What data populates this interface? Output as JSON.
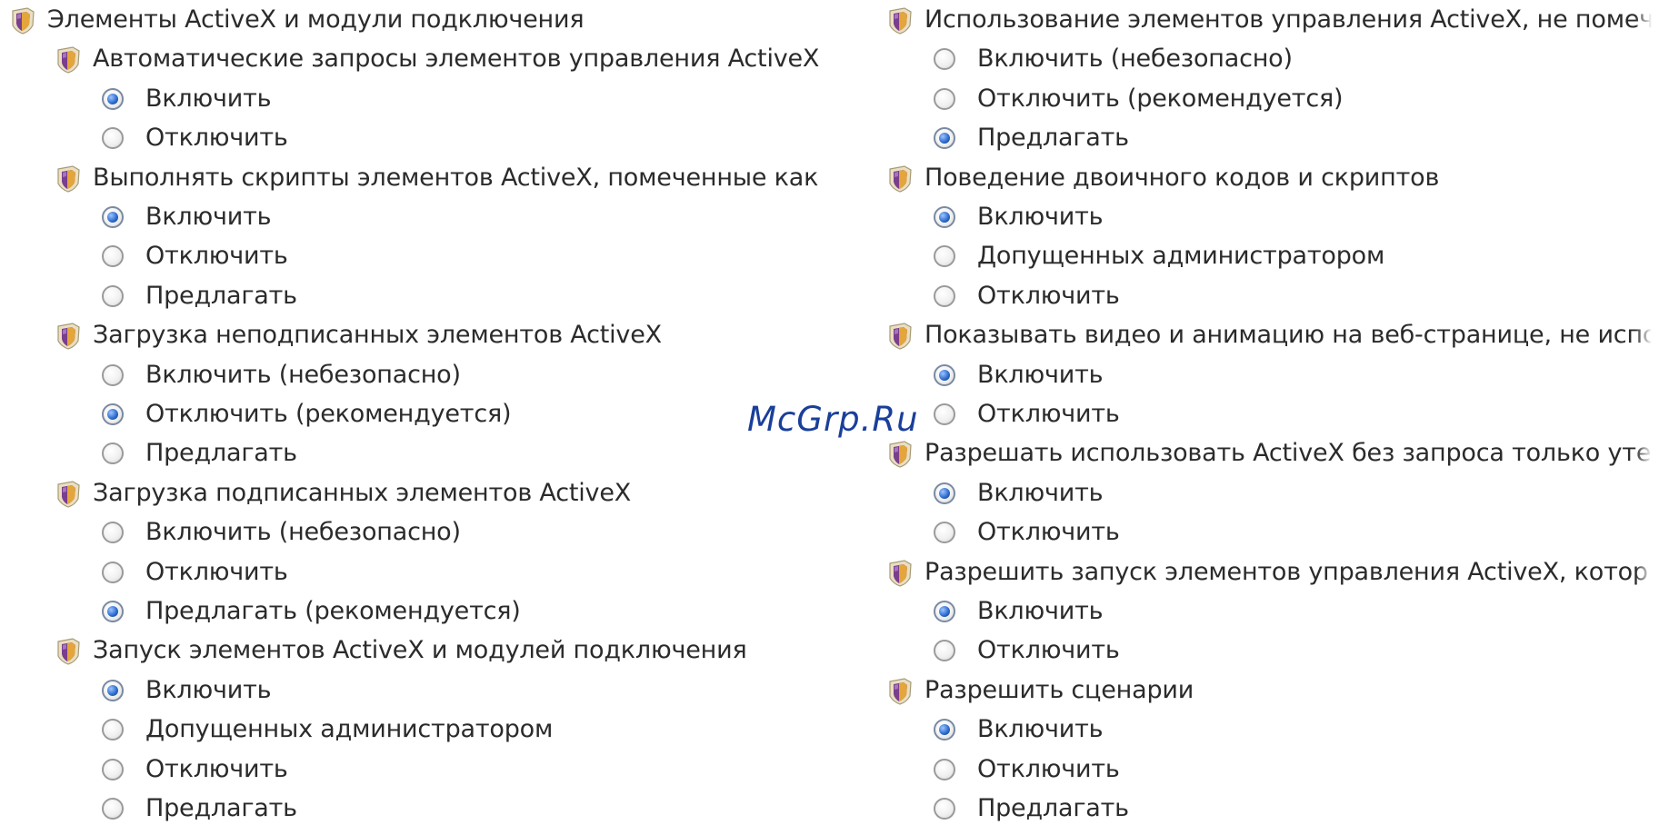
{
  "left_column": [
    {
      "type": "group",
      "label": "Элементы ActiveX и модули подключения",
      "level": 0
    },
    {
      "type": "setting",
      "label": "Автоматические запросы элементов управления ActiveX",
      "level": 1
    },
    {
      "type": "option",
      "label": "Включить",
      "selected": true
    },
    {
      "type": "option",
      "label": "Отключить",
      "selected": false
    },
    {
      "type": "setting",
      "label": "Выполнять скрипты элементов ActiveX, помеченные как",
      "level": 1
    },
    {
      "type": "option",
      "label": "Включить",
      "selected": true
    },
    {
      "type": "option",
      "label": "Отключить",
      "selected": false
    },
    {
      "type": "option",
      "label": "Предлагать",
      "selected": false
    },
    {
      "type": "setting",
      "label": "Загрузка неподписанных элементов ActiveX",
      "level": 1
    },
    {
      "type": "option",
      "label": "Включить (небезопасно)",
      "selected": false
    },
    {
      "type": "option",
      "label": "Отключить (рекомендуется)",
      "selected": true
    },
    {
      "type": "option",
      "label": "Предлагать",
      "selected": false
    },
    {
      "type": "setting",
      "label": "Загрузка подписанных элементов ActiveX",
      "level": 1
    },
    {
      "type": "option",
      "label": "Включить (небезопасно)",
      "selected": false
    },
    {
      "type": "option",
      "label": "Отключить",
      "selected": false
    },
    {
      "type": "option",
      "label": "Предлагать (рекомендуется)",
      "selected": true
    },
    {
      "type": "setting",
      "label": "Запуск элементов ActiveX и модулей подключения",
      "level": 1
    },
    {
      "type": "option",
      "label": "Включить",
      "selected": true
    },
    {
      "type": "option",
      "label": "Допущенных администратором",
      "selected": false
    },
    {
      "type": "option",
      "label": "Отключить",
      "selected": false
    },
    {
      "type": "option",
      "label": "Предлагать",
      "selected": false
    }
  ],
  "right_column": [
    {
      "type": "setting",
      "label": "Использование элементов управления ActiveX, не помеч",
      "level": 1
    },
    {
      "type": "option",
      "label": "Включить (небезопасно)",
      "selected": false
    },
    {
      "type": "option",
      "label": "Отключить (рекомендуется)",
      "selected": false
    },
    {
      "type": "option",
      "label": "Предлагать",
      "selected": true
    },
    {
      "type": "setting",
      "label": "Поведение двоичного кодов и скриптов",
      "level": 1
    },
    {
      "type": "option",
      "label": "Включить",
      "selected": true
    },
    {
      "type": "option",
      "label": "Допущенных администратором",
      "selected": false
    },
    {
      "type": "option",
      "label": "Отключить",
      "selected": false
    },
    {
      "type": "setting",
      "label": "Показывать видео и анимацию на веб-странице, не испс",
      "level": 1
    },
    {
      "type": "option",
      "label": "Включить",
      "selected": true
    },
    {
      "type": "option",
      "label": "Отключить",
      "selected": false
    },
    {
      "type": "setting",
      "label": "Разрешать использовать ActiveX без запроса только уте",
      "level": 1
    },
    {
      "type": "option",
      "label": "Включить",
      "selected": true
    },
    {
      "type": "option",
      "label": "Отключить",
      "selected": false
    },
    {
      "type": "setting",
      "label": "Разрешить запуск элементов управления ActiveX, котор",
      "level": 1
    },
    {
      "type": "option",
      "label": "Включить",
      "selected": true
    },
    {
      "type": "option",
      "label": "Отключить",
      "selected": false
    },
    {
      "type": "setting",
      "label": "Разрешить сценарии",
      "level": 1
    },
    {
      "type": "option",
      "label": "Включить",
      "selected": true
    },
    {
      "type": "option",
      "label": "Отключить",
      "selected": false
    },
    {
      "type": "option",
      "label": "Предлагать",
      "selected": false
    }
  ],
  "watermark": "McGrp.Ru",
  "icons": {
    "setting": "security-shield-icon",
    "option": "radio-button"
  },
  "colors": {
    "text": "#2b2b2b",
    "radio_selected": "#2f6fd0",
    "watermark": "#1a3f9a"
  }
}
